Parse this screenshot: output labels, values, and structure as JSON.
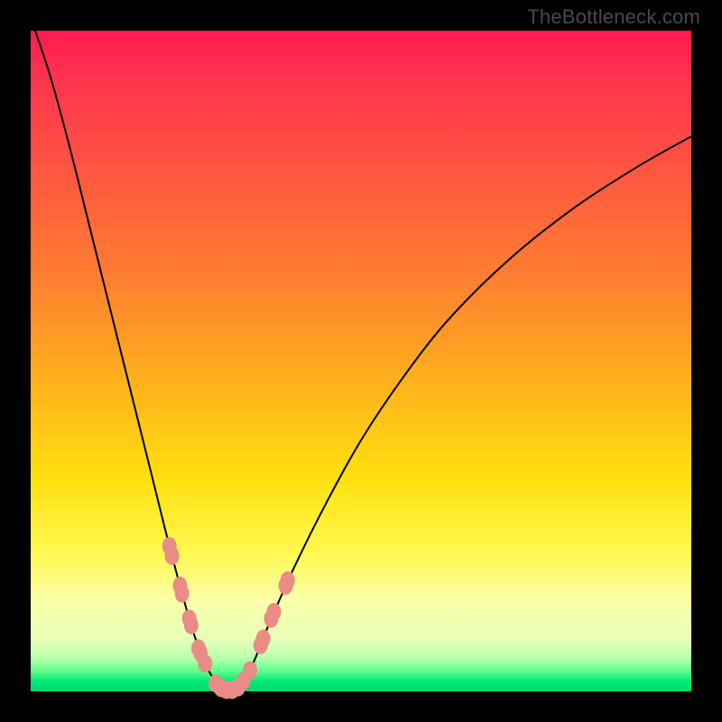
{
  "watermark": "TheBottleneck.com",
  "colors": {
    "gradient_top": "#ff1a4d",
    "gradient_bottom": "#00d870",
    "curve": "#000000",
    "marker": "#e98b86",
    "frame": "#000000"
  },
  "chart_data": {
    "type": "line",
    "title": "",
    "xlabel": "",
    "ylabel": "",
    "xlim": [
      0,
      100
    ],
    "ylim": [
      0,
      100
    ],
    "grid": false,
    "legend": false,
    "x": [
      0,
      3,
      6,
      9,
      12,
      15,
      18,
      21,
      24,
      26,
      27.5,
      28.5,
      29.3,
      30,
      30.6,
      31.3,
      32.3,
      34,
      36,
      40,
      45,
      50,
      56,
      63,
      72,
      82,
      92,
      100
    ],
    "y": [
      102,
      93,
      82,
      70,
      58,
      46,
      34,
      22,
      11,
      5,
      2.2,
      1.0,
      0.4,
      0.2,
      0.2,
      0.5,
      1.5,
      5,
      10,
      19,
      29,
      38,
      47,
      56,
      65,
      73,
      79.5,
      84
    ],
    "markers_x": [
      21.0,
      21.4,
      22.6,
      22.9,
      24.0,
      24.3,
      25.4,
      25.7,
      26.4,
      28.0,
      28.8,
      29.6,
      30.5,
      31.4,
      32.2,
      33.2,
      34.8,
      35.2,
      36.4,
      36.8,
      38.6,
      38.9
    ],
    "markers_y": [
      22.0,
      20.5,
      16.0,
      14.8,
      11.0,
      10.0,
      6.5,
      5.8,
      4.2,
      1.2,
      0.5,
      0.2,
      0.2,
      0.6,
      1.6,
      3.2,
      7.0,
      8.0,
      11.0,
      12.0,
      16.0,
      16.8
    ]
  }
}
